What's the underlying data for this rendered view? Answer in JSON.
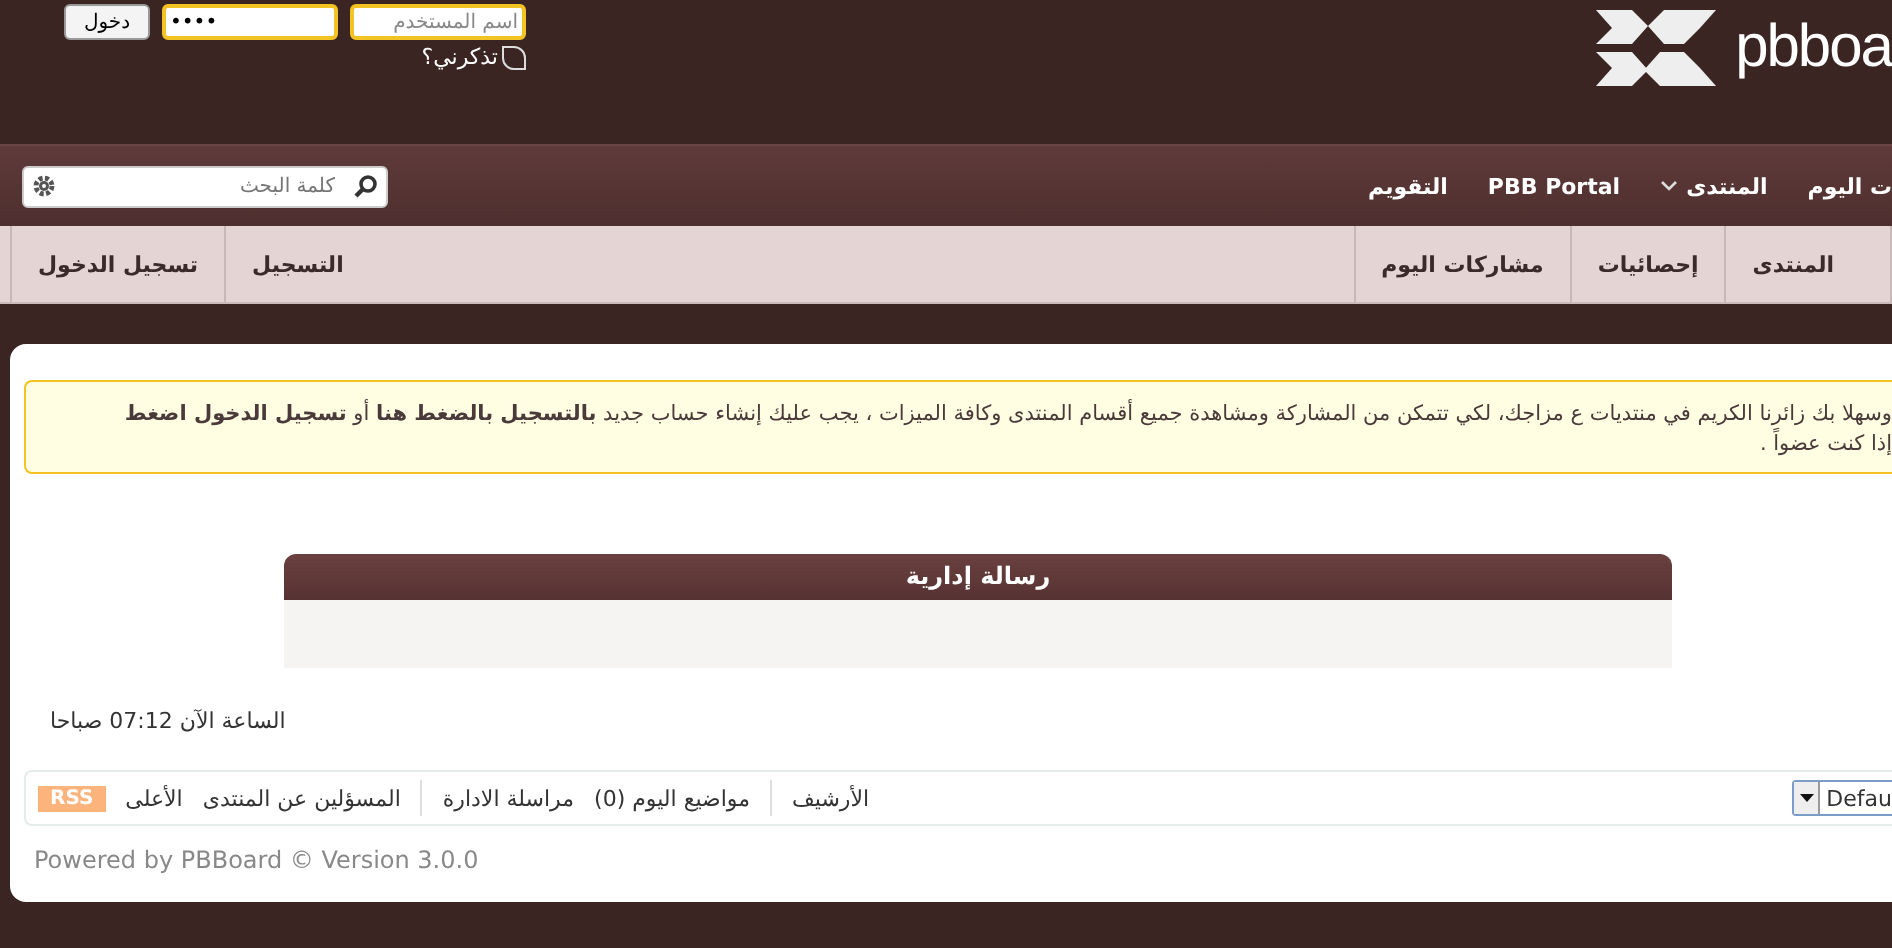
{
  "login": {
    "button": "دخول",
    "password": {
      "value": "••••"
    },
    "username": {
      "placeholder": "اسم المستخدم"
    },
    "remember": {
      "label": "تذكرني؟",
      "checked": false
    }
  },
  "logo": {
    "text": "pbboa"
  },
  "search": {
    "placeholder": "كلمة البحث"
  },
  "nav": [
    {
      "label": "ت اليوم",
      "dropdown": false
    },
    {
      "label": "المنتدى",
      "dropdown": true
    },
    {
      "label": "PBB Portal",
      "dropdown": false
    },
    {
      "label": "التقويم",
      "dropdown": false
    }
  ],
  "subnav_left": [
    "التسجيل",
    "تسجيل الدخول"
  ],
  "subnav_right": [
    "المنتدى",
    "إحصائيات",
    "مشاركات اليوم"
  ],
  "notice": {
    "line_1": "وسهلا بك زائرنا الكريم في منتديات ع مزاجك، لكي تتمكن من المشاركة ومشاهدة جميع أقسام المنتدى وكافة الميزات ، يجب عليك إنشاء حساب جديد **بالتسجيل بالضغط هنا** أو **تسجيل الدخول اضغط**",
    "line_2": "إذا كنت عضواً ."
  },
  "admin_message": {
    "title": "رسالة إدارية"
  },
  "clock": "الساعة الآن 07:12 صباحا",
  "footer_links": [
    {
      "kind": "link",
      "label": "الأرشيف"
    },
    {
      "kind": "divider"
    },
    {
      "kind": "link",
      "label": "مواضيع اليوم (0)"
    },
    {
      "kind": "link",
      "label": "مراسلة الادارة"
    },
    {
      "kind": "divider"
    },
    {
      "kind": "link",
      "label": "المسؤلين عن المنتدى"
    },
    {
      "kind": "link",
      "label": "الأعلى"
    },
    {
      "kind": "badge",
      "label": "RSS"
    }
  ],
  "style_select": {
    "value": "Defau"
  },
  "powered_by": "Powered by PBBoard © Version 3.0.0"
}
